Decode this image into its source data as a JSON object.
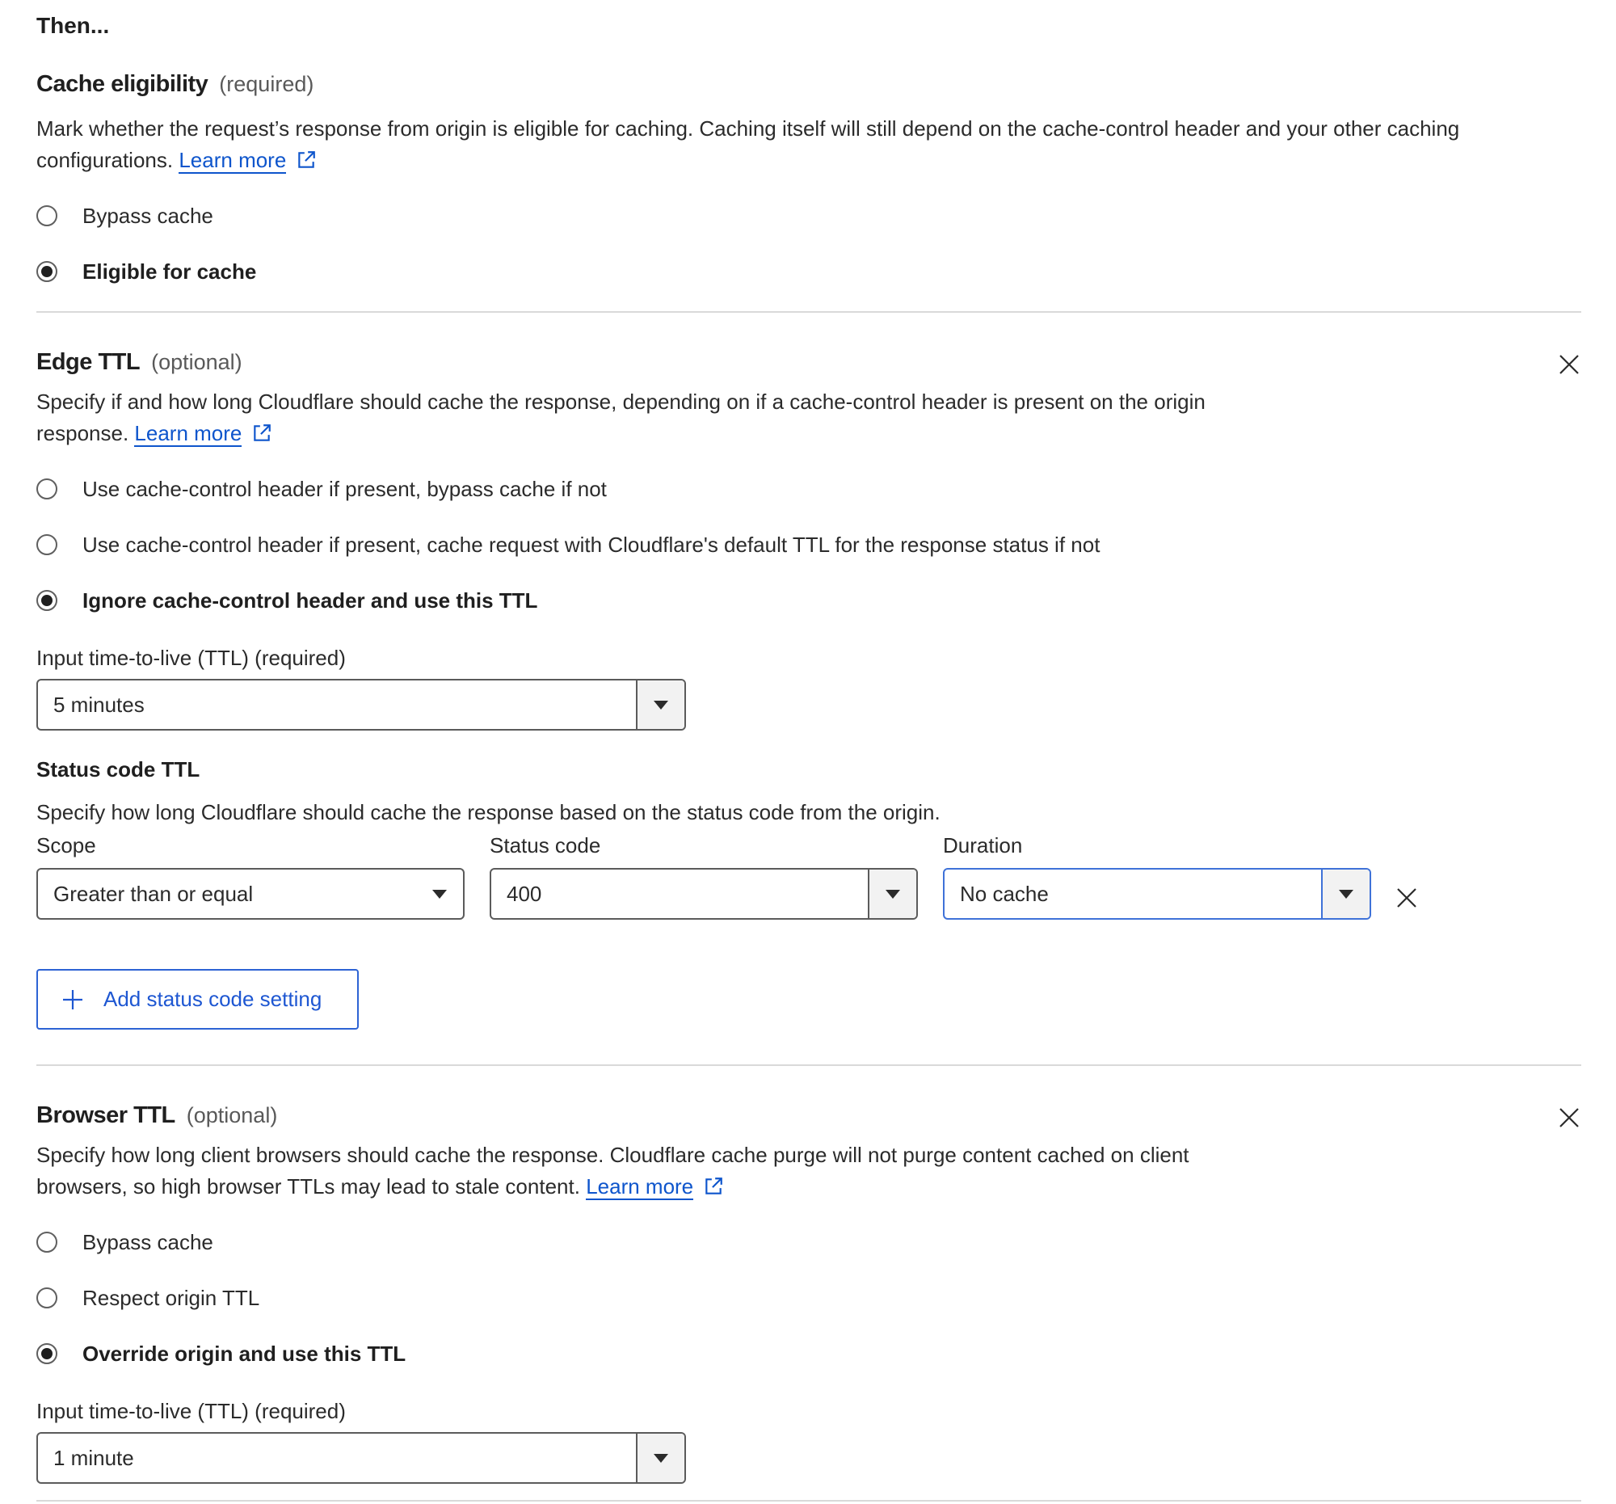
{
  "then_heading": "Then...",
  "cache_eligibility": {
    "title": "Cache eligibility",
    "hint": "(required)",
    "description": "Mark whether the request’s response from origin is eligible for caching. Caching itself will still depend on the cache-control header and your other caching",
    "description_line2": "configurations.",
    "learn_more": "Learn more",
    "options": [
      {
        "label": "Bypass cache",
        "selected": false
      },
      {
        "label": "Eligible for cache",
        "selected": true
      }
    ]
  },
  "edge_ttl": {
    "title": "Edge TTL",
    "hint": "(optional)",
    "description": "Specify if and how long Cloudflare should cache the response, depending on if a cache-control header is present on the origin",
    "description_line2": "response.",
    "learn_more": "Learn more",
    "options": [
      {
        "label": "Use cache-control header if present, bypass cache if not",
        "selected": false
      },
      {
        "label": "Use cache-control header if present, cache request with Cloudflare's default TTL for the response status if not",
        "selected": false
      },
      {
        "label": "Ignore cache-control header and use this TTL",
        "selected": true
      }
    ],
    "ttl_label": "Input time-to-live (TTL) (required)",
    "ttl_value": "5 minutes",
    "status_code_ttl": {
      "title": "Status code TTL",
      "description": "Specify how long Cloudflare should cache the response based on the status code from the origin.",
      "scope_label": "Scope",
      "scope_value": "Greater than or equal",
      "status_label": "Status code",
      "status_value": "400",
      "duration_label": "Duration",
      "duration_value": "No cache",
      "add_button": "Add status code setting"
    }
  },
  "browser_ttl": {
    "title": "Browser TTL",
    "hint": "(optional)",
    "description": "Specify how long client browsers should cache the response. Cloudflare cache purge will not purge content cached on client",
    "description_line2": "browsers, so high browser TTLs may lead to stale content.",
    "learn_more": "Learn more",
    "options": [
      {
        "label": "Bypass cache",
        "selected": false
      },
      {
        "label": "Respect origin TTL",
        "selected": false
      },
      {
        "label": "Override origin and use this TTL",
        "selected": true
      }
    ],
    "ttl_label": "Input time-to-live (TTL) (required)",
    "ttl_value": "1 minute"
  },
  "icons": {
    "external_link": "external-link-icon",
    "close": "close-icon",
    "caret": "caret-down-icon",
    "plus": "plus-icon"
  },
  "colors": {
    "link": "#0e55cc",
    "focus_border": "#3f72d8",
    "button_border": "#2d63d4",
    "divider": "#d9d9d9"
  }
}
